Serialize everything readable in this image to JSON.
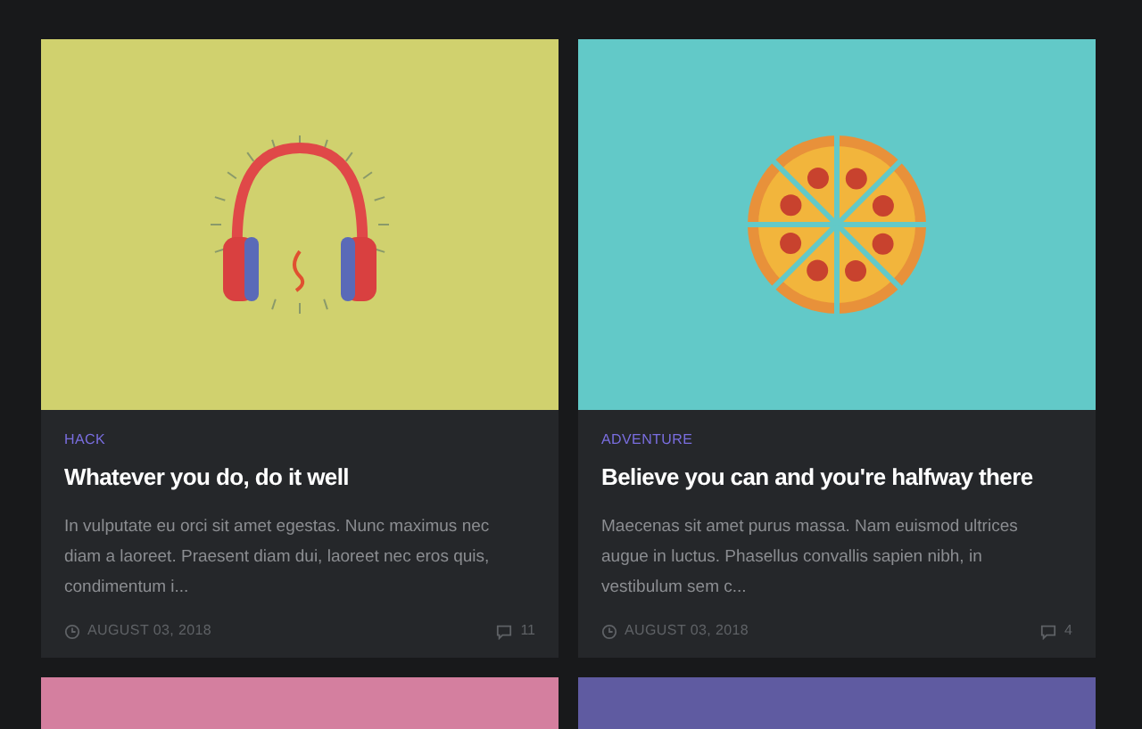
{
  "posts": [
    {
      "kind": "headphones",
      "color": "#d0d16e",
      "category": "HACK",
      "title": "Whatever you do, do it well",
      "excerpt": "In vulputate eu orci sit amet egestas. Nunc maximus nec diam a laoreet. Praesent diam dui, laoreet nec eros quis, condimentum i...",
      "date": "AUGUST 03, 2018",
      "comments": "11"
    },
    {
      "kind": "pizza",
      "color": "#62c9c8",
      "category": "ADVENTURE",
      "title": "Believe you can and you're halfway there",
      "excerpt": "Maecenas sit amet purus massa. Nam euismod ultrices augue in luctus. Phasellus convallis sapien nibh, in vestibulum sem c...",
      "date": "AUGUST 03, 2018",
      "comments": "4"
    },
    {
      "kind": "picture",
      "color": "#d47f9f"
    },
    {
      "kind": "picture",
      "color": "#5f5ba1"
    }
  ]
}
